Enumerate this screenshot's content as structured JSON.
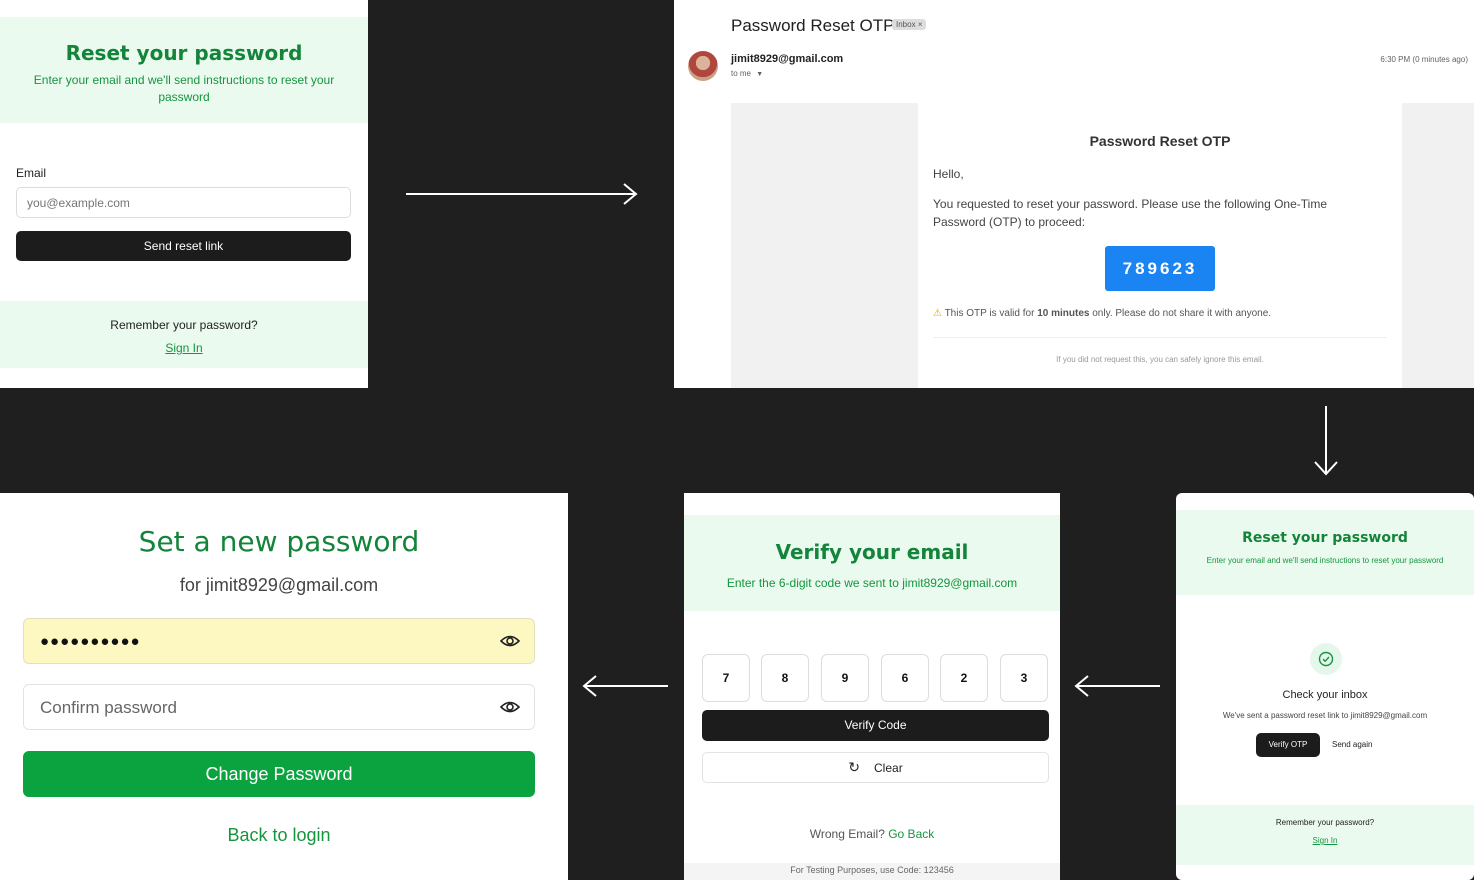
{
  "reset_form": {
    "title": "Reset your password",
    "subtitle": "Enter your email and we'll send instructions to reset your password",
    "email_label": "Email",
    "email_placeholder": "you@example.com",
    "send_button": "Send reset link",
    "remember_text": "Remember your password?",
    "sign_in": "Sign In"
  },
  "email_view": {
    "subject": "Password Reset OTP",
    "inbox_badge": "Inbox",
    "badge_close": "×",
    "sender": "jimit8929@gmail.com",
    "to_me": "to me",
    "time": "6:30 PM (0 minutes ago)",
    "body_title": "Password Reset OTP",
    "greeting": "Hello,",
    "message": "You requested to reset your password. Please use the following One-Time Password (OTP) to proceed:",
    "otp": "789623",
    "validity_prefix": "This OTP is valid for ",
    "validity_bold": "10 minutes",
    "validity_suffix": " only. Please do not share it with anyone.",
    "footer": "If you did not request this, you can safely ignore this email."
  },
  "check_inbox": {
    "title": "Reset your password",
    "subtitle": "Enter your email and we'll send instructions to reset your password",
    "heading": "Check your inbox",
    "message": "We've sent a password reset link to jimit8929@gmail.com",
    "verify_otp": "Verify OTP",
    "send_again": "Send again",
    "remember_text": "Remember your password?",
    "sign_in": "Sign In"
  },
  "verify_email": {
    "title": "Verify your email",
    "subtitle": "Enter the 6-digit code we sent to jimit8929@gmail.com",
    "digits": [
      "7",
      "8",
      "9",
      "6",
      "2",
      "3"
    ],
    "verify_button": "Verify Code",
    "clear_button": "Clear",
    "wrong_email": "Wrong Email?",
    "go_back": "Go Back",
    "testing_note": "For Testing Purposes, use Code: 123456"
  },
  "new_password": {
    "title": "Set a new password",
    "subtitle": "for jimit8929@gmail.com",
    "password_value": "●●●●●●●●●●",
    "confirm_placeholder": "Confirm password",
    "change_button": "Change Password",
    "back_login": "Back to login"
  },
  "colors": {
    "accent_green": "#13843a",
    "light_green": "#eafaee",
    "otp_blue": "#1a84f2",
    "change_green": "#0aa33f"
  },
  "icons": [
    "arrow-right-icon",
    "arrow-down-icon",
    "arrow-left-icon",
    "check-circle-icon",
    "eye-icon",
    "refresh-icon",
    "warning-icon",
    "caret-down-icon"
  ]
}
